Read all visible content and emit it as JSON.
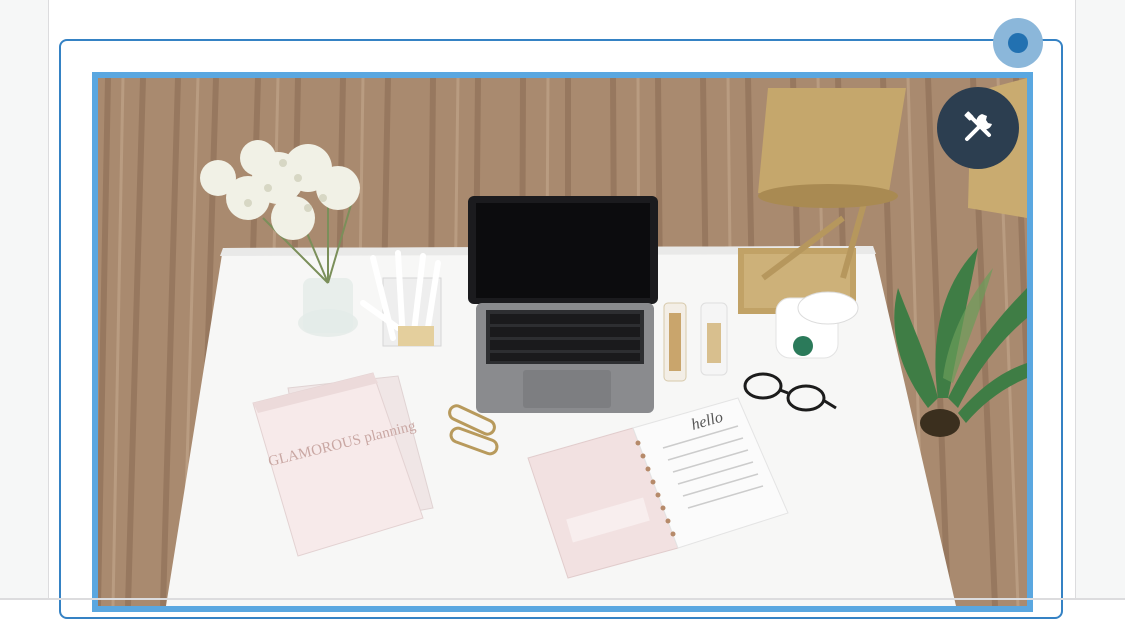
{
  "editor": {
    "selected_block": "image",
    "image": {
      "alt": "Desk with laptop, lamp, plant, flowers and planner",
      "planner_cover_text": "GLAMOROUS planning",
      "notebook_text": "hello"
    },
    "toolbar": {
      "tools_icon": "wrench-screwdriver-icon"
    },
    "drag_handle_icon": "move-handle-icon"
  },
  "colors": {
    "accent": "#3582c4",
    "tools_bg": "#2c3e50"
  }
}
